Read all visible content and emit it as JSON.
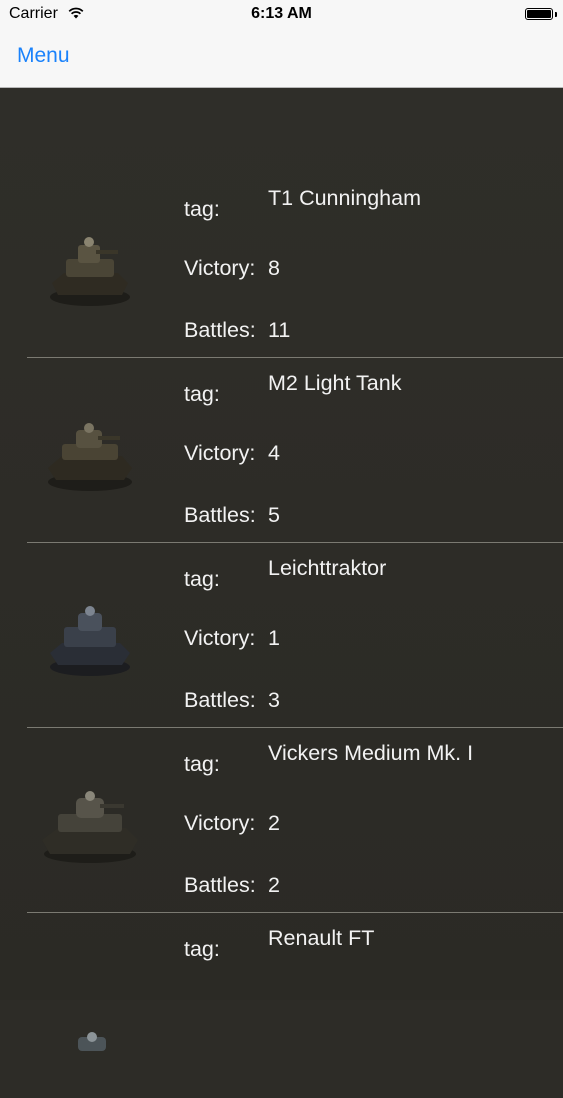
{
  "status_bar": {
    "carrier": "Carrier",
    "time": "6:13 AM"
  },
  "nav": {
    "menu_label": "Menu"
  },
  "labels": {
    "tag": "tag:",
    "victory": "Victory:",
    "battles": "Battles:"
  },
  "tanks": [
    {
      "name": "T1 Cunningham",
      "victory": "8",
      "battles": "11",
      "color": "#4a4536"
    },
    {
      "name": "M2 Light Tank",
      "victory": "4",
      "battles": "5",
      "color": "#4a4434"
    },
    {
      "name": "Leichttraktor",
      "victory": "1",
      "battles": "3",
      "color": "#3a404a"
    },
    {
      "name": "Vickers Medium Mk. I",
      "victory": "2",
      "battles": "2",
      "color": "#45433a"
    },
    {
      "name": "Renault FT",
      "victory": "",
      "battles": "",
      "color": "#4c5458"
    }
  ],
  "colors": {
    "accent": "#1a82fb",
    "list_background": "#2d2c27",
    "text": "#f2f2f2"
  }
}
